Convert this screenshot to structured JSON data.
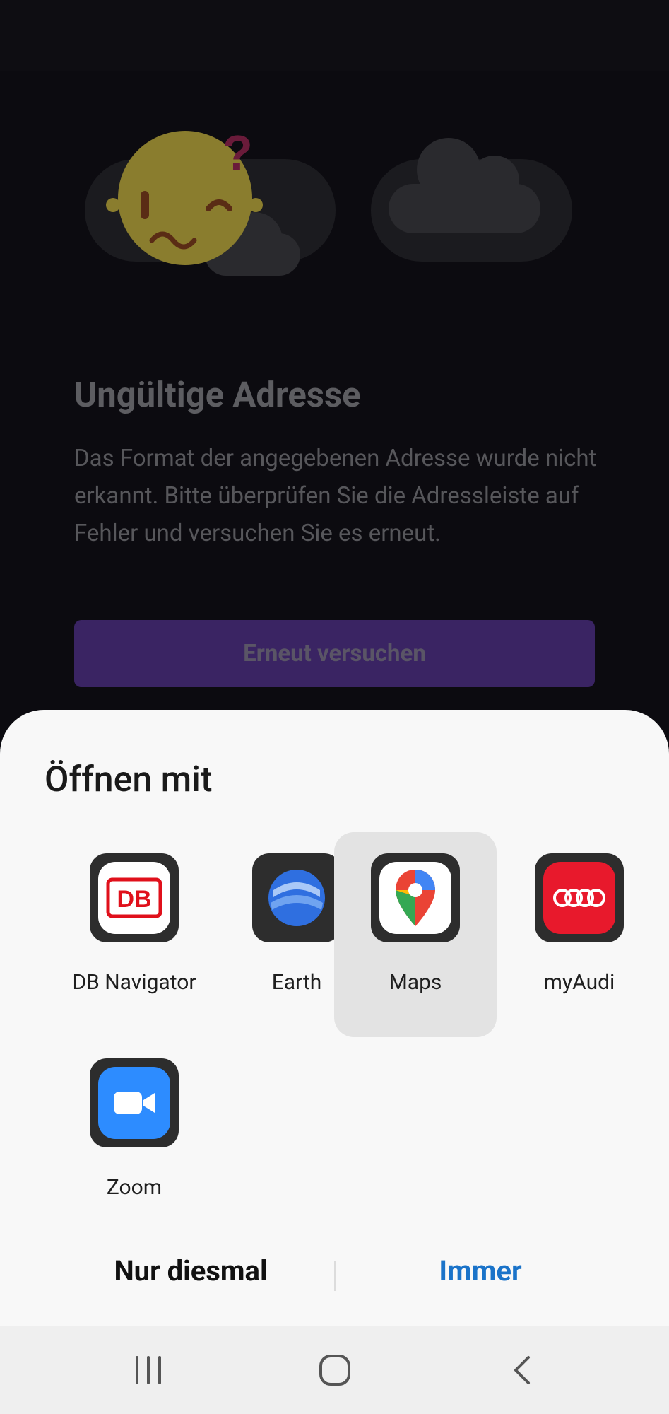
{
  "error_page": {
    "title": "Ungültige Adresse",
    "message": "Das Format der angegebenen Adresse wurde nicht erkannt. Bitte überprüfen Sie die Adressleiste auf Fehler und versuchen Sie es erneut.",
    "retry_label": "Erneut versuchen"
  },
  "sheet": {
    "title": "Öffnen mit",
    "apps": [
      {
        "label": "DB Navigator",
        "icon": "db-navigator-icon"
      },
      {
        "label": "Earth",
        "icon": "google-earth-icon"
      },
      {
        "label": "Maps",
        "icon": "google-maps-icon",
        "selected": true
      },
      {
        "label": "myAudi",
        "icon": "myaudi-icon"
      },
      {
        "label": "Zoom",
        "icon": "zoom-icon"
      }
    ],
    "once_label": "Nur diesmal",
    "always_label": "Immer"
  },
  "navbar": {
    "recents": "recents-icon",
    "home": "home-icon",
    "back": "back-icon"
  },
  "colors": {
    "accent": "#1a73c9",
    "retry_button": "#3a2463",
    "sheet_background": "#f8f8f8"
  }
}
